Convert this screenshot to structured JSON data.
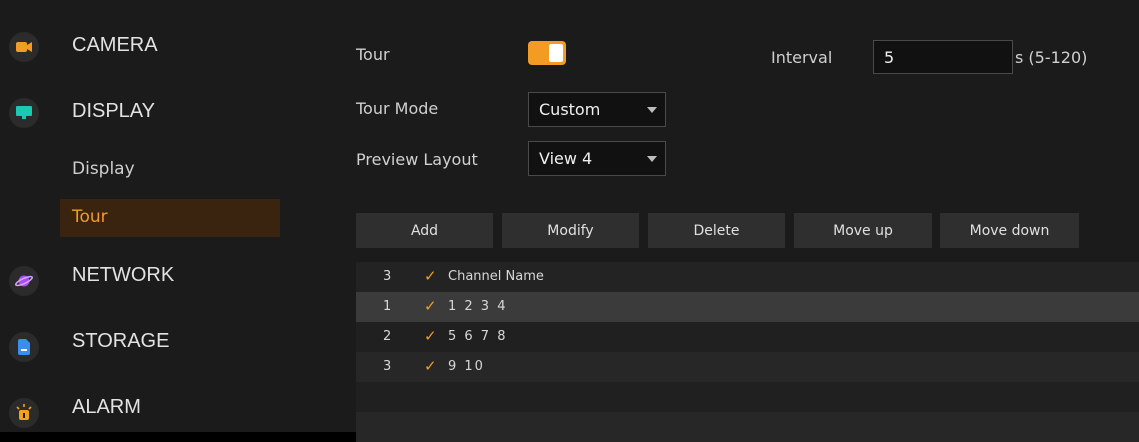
{
  "sidebar": {
    "items": [
      {
        "label": "CAMERA",
        "icon": "camera-icon",
        "icon_color": "#f39c24"
      },
      {
        "label": "DISPLAY",
        "icon": "monitor-icon",
        "icon_color": "#1ec7b4"
      },
      {
        "label": "NETWORK",
        "icon": "planet-icon",
        "icon_color": "#a64df0"
      },
      {
        "label": "STORAGE",
        "icon": "storage-icon",
        "icon_color": "#3b8ef0"
      },
      {
        "label": "ALARM",
        "icon": "alarm-icon",
        "icon_color": "#f2a21b"
      }
    ],
    "subitems": [
      {
        "label": "Display",
        "active": false
      },
      {
        "label": "Tour",
        "active": true
      }
    ]
  },
  "form": {
    "tour_label": "Tour",
    "tour_enabled": true,
    "interval_label": "Interval",
    "interval_value": "5",
    "interval_unit": "s (5-120)",
    "tour_mode_label": "Tour Mode",
    "tour_mode_value": "Custom",
    "preview_layout_label": "Preview Layout",
    "preview_layout_value": "View 4"
  },
  "toolbar": {
    "add": "Add",
    "modify": "Modify",
    "delete": "Delete",
    "move_up": "Move up",
    "move_down": "Move down"
  },
  "table": {
    "header": {
      "count": "3",
      "column": "Channel Name"
    },
    "rows": [
      {
        "index": "1",
        "channels": "1 2 3 4",
        "checked": true,
        "selected": true
      },
      {
        "index": "2",
        "channels": "5 6 7 8",
        "checked": true,
        "selected": false
      },
      {
        "index": "3",
        "channels": "9 10",
        "checked": true,
        "selected": false
      }
    ]
  },
  "colors": {
    "accent": "#f39c24",
    "active_bg": "#3a2410"
  }
}
